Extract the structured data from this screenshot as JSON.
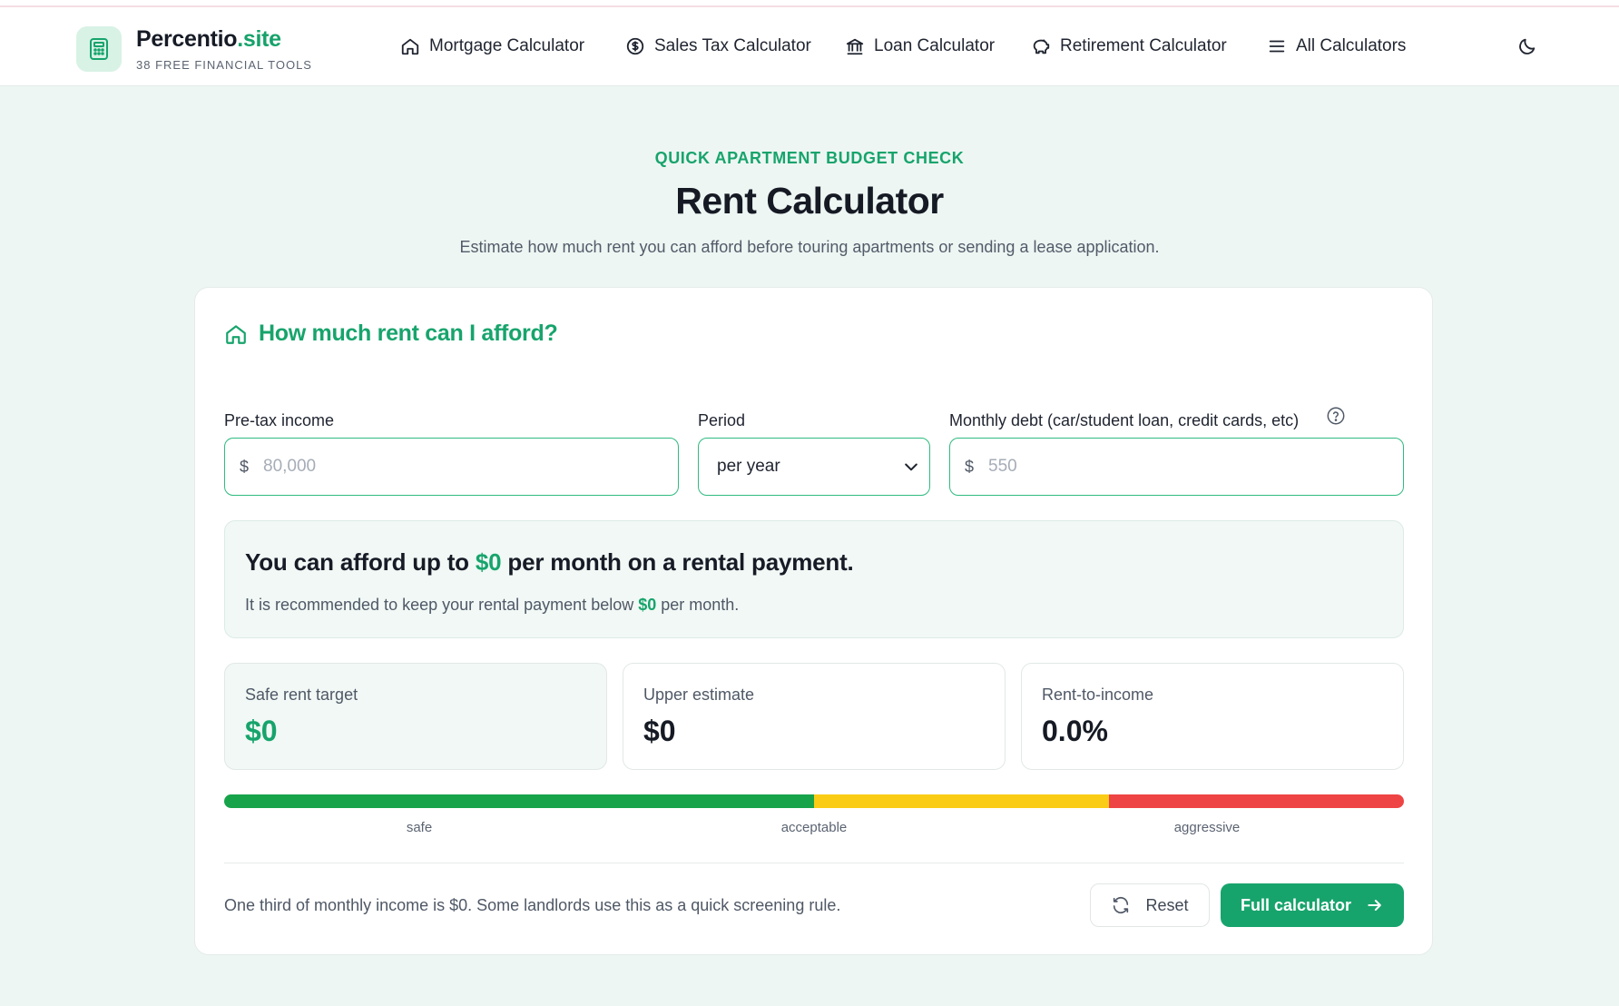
{
  "brand": {
    "name_main": "Percentio",
    "name_accent": ".site",
    "tagline": "38 FREE FINANCIAL TOOLS",
    "logo_icon": "calculator-icon"
  },
  "nav": {
    "items": [
      {
        "label": "Mortgage Calculator",
        "icon": "house-icon"
      },
      {
        "label": "Sales Tax Calculator",
        "icon": "dollar-circle-icon"
      },
      {
        "label": "Loan Calculator",
        "icon": "bank-icon"
      },
      {
        "label": "Retirement Calculator",
        "icon": "piggy-bank-icon"
      },
      {
        "label": "All Calculators",
        "icon": "menu-icon"
      }
    ],
    "theme_toggle_icon": "moon-icon"
  },
  "hero": {
    "eyebrow": "QUICK APARTMENT BUDGET CHECK",
    "title": "Rent Calculator",
    "subtitle": "Estimate how much rent you can afford before touring apartments or sending a lease application."
  },
  "card": {
    "title": "How much rent can I afford?",
    "title_icon": "house-icon",
    "fields": {
      "income": {
        "label": "Pre-tax income",
        "prefix": "$",
        "placeholder": "80,000",
        "value": ""
      },
      "period": {
        "label": "Period",
        "selected": "per year"
      },
      "debt": {
        "label": "Monthly debt (car/student loan, credit cards, etc)",
        "prefix": "$",
        "placeholder": "550",
        "value": "",
        "help_icon": "question-circle-icon"
      }
    },
    "result": {
      "prefix": "You can afford up to ",
      "amount": "$0",
      "suffix": " per month on a rental payment.",
      "sub_prefix": "It is recommended to keep your rental payment below ",
      "sub_amount": "$0",
      "sub_suffix": " per month."
    },
    "stats": [
      {
        "label": "Safe rent target",
        "value": "$0"
      },
      {
        "label": "Upper estimate",
        "value": "$0"
      },
      {
        "label": "Rent-to-income",
        "value": "0.0%"
      }
    ],
    "scale": {
      "labels": [
        "safe",
        "acceptable",
        "aggressive"
      ],
      "colors": {
        "safe": "#17a34a",
        "acceptable": "#facc15",
        "aggressive": "#ef4444"
      }
    },
    "footnote": "One third of monthly income is $0. Some landlords use this as a quick screening rule.",
    "buttons": {
      "reset": "Reset",
      "reset_icon": "refresh-icon",
      "full": "Full calculator",
      "full_icon": "arrow-right-icon"
    }
  },
  "colors": {
    "accent": "#17a46c",
    "background": "#eef6f3"
  }
}
